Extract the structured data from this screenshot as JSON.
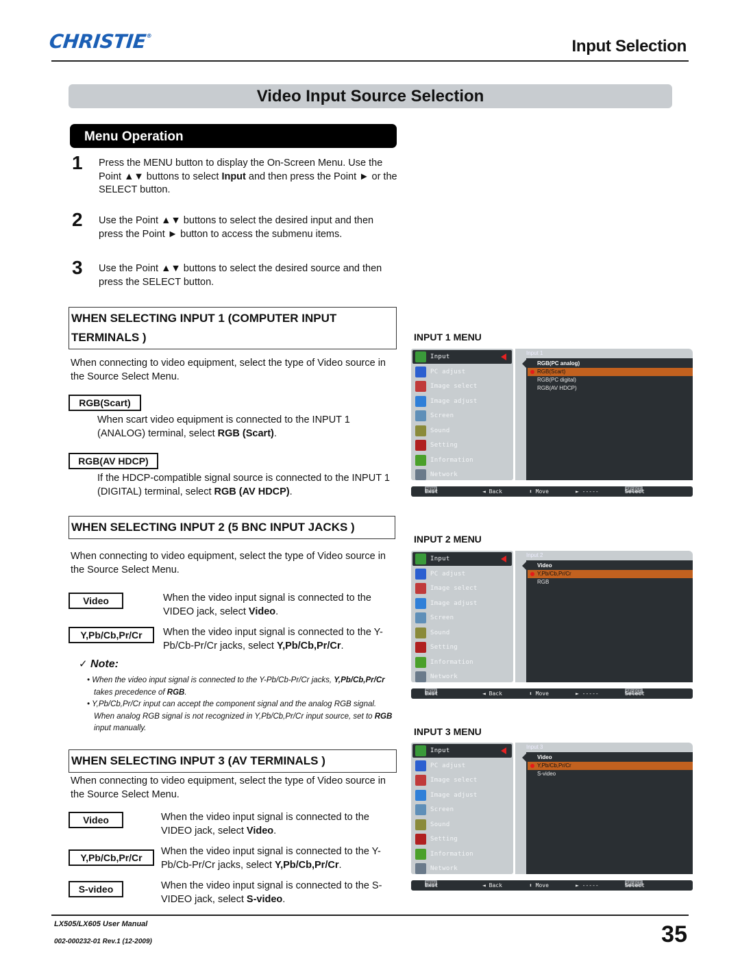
{
  "header": {
    "logo": "CHRISTIE",
    "logo_mark": "®",
    "title": "Input Selection"
  },
  "section_title": "Video Input Source Selection",
  "menu_operation": {
    "title": "Menu Operation",
    "steps": [
      {
        "num": "1",
        "text_html": "Press the MENU button to display the On-Screen Menu. Use the Point ▲▼ buttons to select <b>Input</b> and then press the Point ► or the SELECT button."
      },
      {
        "num": "2",
        "text_html": "Use the Point ▲▼ buttons to select the desired input and then press the Point ► button to access the submenu items."
      },
      {
        "num": "3",
        "text_html": "Use the Point ▲▼ buttons to select the desired source and then press the SELECT button."
      }
    ]
  },
  "input1": {
    "heading_line1": "WHEN SELECTING INPUT 1 (COMPUTER INPUT",
    "heading_line2": "TERMINALS )",
    "intro": "When connecting to video equipment, select the type of Video source in the Source Select Menu.",
    "options": [
      {
        "tag": "RGB(Scart)",
        "text_html": "When scart video equipment is connected to the INPUT 1 (ANALOG) terminal, select <b>RGB (Scart)</b>."
      },
      {
        "tag": "RGB(AV HDCP)",
        "text_html": "If the HDCP-compatible signal source is connected to the INPUT 1 (DIGITAL) terminal, select <b>RGB (AV HDCP)</b>."
      }
    ]
  },
  "input2": {
    "heading": "WHEN SELECTING INPUT 2 (5 BNC INPUT JACKS )",
    "intro": "When connecting to video equipment, select the type of Video source in the Source Select Menu.",
    "options": [
      {
        "tag": "Video",
        "text_html": "When the video input signal is connected to the VIDEO jack, select <b>Video</b>."
      },
      {
        "tag": "Y,Pb/Cb,Pr/Cr",
        "text_html": "When the video input signal is connected to the Y-Pb/Cb-Pr/Cr jacks, select <b>Y,Pb/Cb,Pr/Cr</b>."
      }
    ]
  },
  "note": {
    "check": "✓",
    "title": "Note:",
    "items": [
      "• When the video input signal is connected to the Y-Pb/Cb-Pr/Cr jacks, <b>Y,Pb/Cb,Pr/Cr</b> takes precedence of <b>RGB</b>.",
      "• Y,Pb/Cb,Pr/Cr input can accept the component signal and the analog RGB signal. When analog RGB signal is not recognized in Y,Pb/Cb,Pr/Cr input source, set to <b>RGB</b> input manually."
    ]
  },
  "input3": {
    "heading": "WHEN SELECTING INPUT 3 (AV TERMINALS )",
    "intro": "When connecting to video equipment, select the type of Video source in the Source Select Menu.",
    "options": [
      {
        "tag": "Video",
        "text_html": "When the video input signal is connected to the VIDEO jack, select <b>Video</b>."
      },
      {
        "tag": "Y,Pb/Cb,Pr/Cr",
        "text_html": "When the video input signal is connected to the Y-Pb/Cb-Pr/Cr jacks, select <b>Y,Pb/Cb,Pr/Cr</b>."
      },
      {
        "tag": "S-video",
        "text_html": "When the video input signal is connected to the S-VIDEO jack, select <b>S-video</b>."
      }
    ]
  },
  "osd_menus": [
    {
      "label": "INPUT 1 MENU",
      "submenu_title": "Input 1",
      "options": [
        "RGB(PC analog)",
        "RGB(Scart)",
        "RGB(PC digital)",
        "RGB(AV HDCP)"
      ],
      "selected_index": 1
    },
    {
      "label": "INPUT 2 MENU",
      "submenu_title": "Input 2",
      "options": [
        "Video",
        "Y,Pb/Cb,Pr/Cr",
        "RGB"
      ],
      "selected_index": 1
    },
    {
      "label": "INPUT 3 MENU",
      "submenu_title": "Input 3",
      "options": [
        "Video",
        "Y,Pb/Cb,Pr/Cr",
        "S-video"
      ],
      "selected_index": 1
    }
  ],
  "osd_main_items": [
    {
      "label": "Input",
      "icon": "input-icon",
      "color": "#3a9a3a"
    },
    {
      "label": "PC adjust",
      "icon": "pc-adjust-icon",
      "color": "#2b5fd0"
    },
    {
      "label": "Image select",
      "icon": "image-select-icon",
      "color": "#c03a3a"
    },
    {
      "label": "Image adjust",
      "icon": "image-adjust-icon",
      "color": "#2f7fd8"
    },
    {
      "label": "Screen",
      "icon": "screen-icon",
      "color": "#5f8fb8"
    },
    {
      "label": "Sound",
      "icon": "sound-icon",
      "color": "#8a8a3a"
    },
    {
      "label": "Setting",
      "icon": "setting-icon",
      "color": "#b02020"
    },
    {
      "label": "Information",
      "icon": "information-icon",
      "color": "#4aa02a"
    },
    {
      "label": "Network",
      "icon": "network-icon",
      "color": "#6a7a8a"
    }
  ],
  "osd_footer": {
    "exit_key": "MENU",
    "exit": "Exit",
    "back": "◄ Back",
    "move": "⬍ Move",
    "next": "► -----",
    "select_key": "SELECT",
    "select": "Select"
  },
  "footer": {
    "manual": "LX505/LX605 User Manual",
    "revision": "002-000232-01 Rev.1 (12-2009)",
    "page_number": "35"
  },
  "colors": {
    "brand": "#1b5fb5",
    "osd_dark": "#2a2f33",
    "osd_light": "#c8cdd0",
    "osd_highlight": "#c2611f",
    "osd_marker": "#e51a1a"
  }
}
